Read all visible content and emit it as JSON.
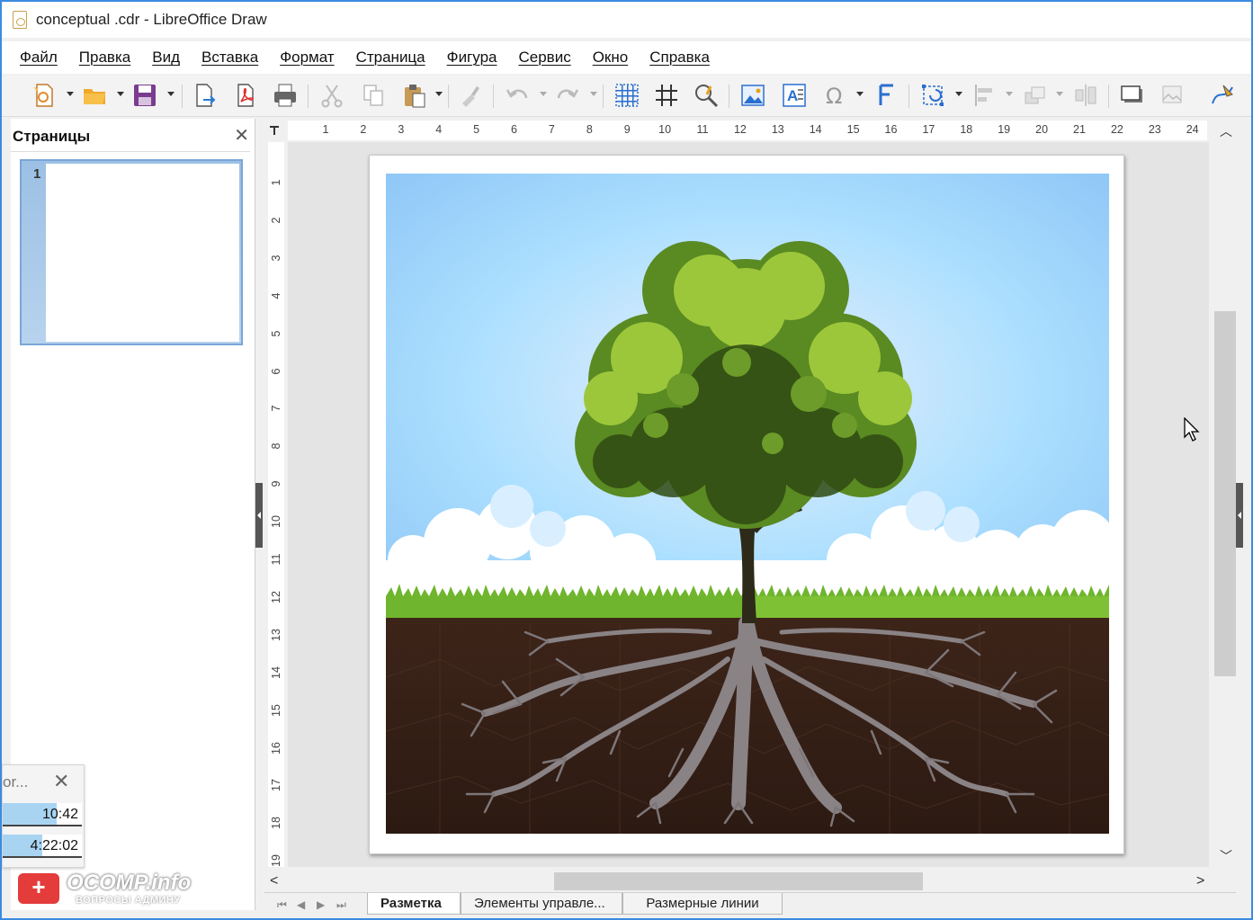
{
  "window": {
    "title": "conceptual .cdr - LibreOffice Draw"
  },
  "menu": [
    "Файл",
    "Правка",
    "Вид",
    "Вставка",
    "Формат",
    "Страница",
    "Фигура",
    "Сервис",
    "Окно",
    "Справка"
  ],
  "pages_panel": {
    "title": "Страницы",
    "close": "✕",
    "page_number": "1"
  },
  "ruler": {
    "horizontal": [
      "1",
      "2",
      "3",
      "4",
      "5",
      "6",
      "7",
      "8",
      "9",
      "10",
      "11",
      "12",
      "13",
      "14",
      "15",
      "16",
      "17",
      "18",
      "19",
      "20",
      "21",
      "22",
      "23",
      "24"
    ],
    "vertical": [
      "1",
      "2",
      "3",
      "4",
      "5",
      "6",
      "7",
      "8",
      "9",
      "10",
      "11",
      "12",
      "13",
      "14",
      "15",
      "16",
      "17",
      "18",
      "19"
    ]
  },
  "floating_window": {
    "title": "or...",
    "close": "✕",
    "rows": [
      {
        "value": "10:42",
        "fill": 0.68
      },
      {
        "value": "4:22:02",
        "fill": 0.5
      }
    ]
  },
  "watermark": {
    "badge": "+",
    "text": "OCOMP.info",
    "subtitle": "ВОПРОСЫ АДМИНУ"
  },
  "layer_tabs": {
    "nav": [
      "⏮",
      "◀",
      "▶",
      "⏭"
    ],
    "tabs": [
      "Разметка",
      "Элементы управле...",
      "Размерные линии"
    ],
    "active": 0
  },
  "scrollbar": {
    "up": "︿",
    "down": "﹀",
    "left": "<",
    "right": ">"
  },
  "colors": {
    "accent": "#3b8be0",
    "sky": "#9ccbf6",
    "soil": "#3a2218",
    "grass": "#7cbf2b"
  }
}
